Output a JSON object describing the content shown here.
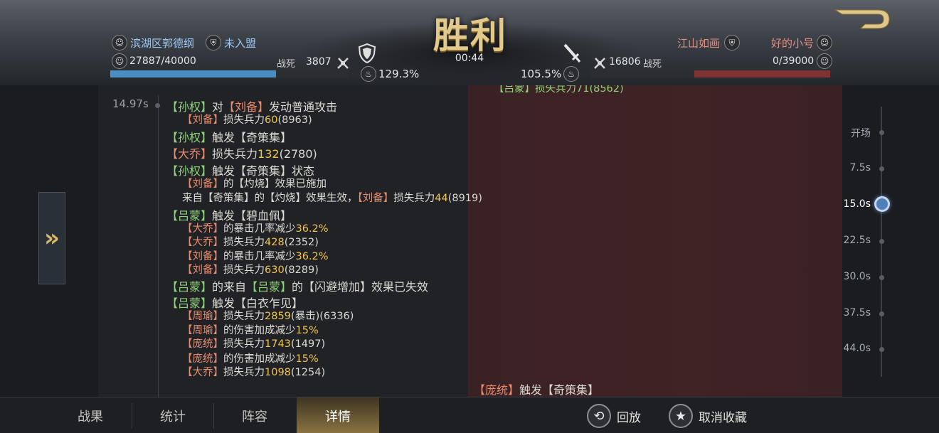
{
  "header": {
    "result_title": "胜利",
    "battle_time": "00:44",
    "back_button_label": ""
  },
  "player": {
    "name": "滨湖区郭德纲",
    "alliance": "未入盟",
    "troops": "27887/40000",
    "troop_fraction": 0.697,
    "killed_label": "战死",
    "killed_value": "3807",
    "stat_percent": "129.3%",
    "side_color": "#4a8fc4"
  },
  "enemy": {
    "name": "好的小号",
    "alliance": "江山如画",
    "troops": "0/39000",
    "troop_fraction": 0.0,
    "killed_label": "战死",
    "killed_value": "16806",
    "stat_percent": "105.5%",
    "side_color": "#a9403c"
  },
  "log": {
    "timestamp": "14.97s",
    "clipped_top_line": "【吕蒙】损失兵力71(8562)",
    "lines": [
      {
        "id": "l1",
        "size": "big",
        "segments": [
          [
            "g",
            "【孙权】"
          ],
          [
            "w",
            "对"
          ],
          [
            "r",
            "【刘备】"
          ],
          [
            "w",
            "发动普通攻击"
          ]
        ]
      },
      {
        "id": "l2",
        "size": "small",
        "segments": [
          [
            "r",
            "【刘备】"
          ],
          [
            "w",
            "损失兵力"
          ],
          [
            "y",
            "60"
          ],
          [
            "w",
            "(8963)"
          ]
        ]
      },
      {
        "id": "l3",
        "size": "big",
        "segments": [
          [
            "g",
            "【孙权】"
          ],
          [
            "w",
            "触发【奇策集】"
          ]
        ]
      },
      {
        "id": "l4",
        "size": "big",
        "segments": [
          [
            "r",
            "【大乔】"
          ],
          [
            "w",
            "损失兵力"
          ],
          [
            "y",
            "132"
          ],
          [
            "w",
            "(2780)"
          ]
        ]
      },
      {
        "id": "l5",
        "size": "big",
        "segments": [
          [
            "g",
            "【孙权】"
          ],
          [
            "w",
            "触发【奇策集】状态"
          ]
        ]
      },
      {
        "id": "l6",
        "size": "small",
        "segments": [
          [
            "r",
            "【刘备】"
          ],
          [
            "w",
            "的【灼烧】效果已施加"
          ]
        ]
      },
      {
        "id": "l7",
        "size": "small",
        "segments": [
          [
            "w",
            "来自【奇策集】的【灼烧】效果生效，"
          ],
          [
            "r",
            "【刘备】"
          ],
          [
            "w",
            "损失兵力"
          ],
          [
            "y",
            "44"
          ],
          [
            "w",
            "(8919)"
          ]
        ]
      },
      {
        "id": "l8",
        "size": "big",
        "segments": [
          [
            "g",
            "【吕蒙】"
          ],
          [
            "w",
            "触发【碧血佩】"
          ]
        ]
      },
      {
        "id": "l9",
        "size": "small",
        "segments": [
          [
            "r",
            "【大乔】"
          ],
          [
            "w",
            "的暴击几率减少"
          ],
          [
            "y",
            "36.2%"
          ]
        ]
      },
      {
        "id": "l10",
        "size": "small",
        "segments": [
          [
            "r",
            "【大乔】"
          ],
          [
            "w",
            "损失兵力"
          ],
          [
            "y",
            "428"
          ],
          [
            "w",
            "(2352)"
          ]
        ]
      },
      {
        "id": "l11",
        "size": "small",
        "segments": [
          [
            "r",
            "【刘备】"
          ],
          [
            "w",
            "的暴击几率减少"
          ],
          [
            "y",
            "36.2%"
          ]
        ]
      },
      {
        "id": "l12",
        "size": "small",
        "segments": [
          [
            "r",
            "【刘备】"
          ],
          [
            "w",
            "损失兵力"
          ],
          [
            "y",
            "630"
          ],
          [
            "w",
            "(8289)"
          ]
        ]
      },
      {
        "id": "l13",
        "size": "big",
        "segments": [
          [
            "g",
            "【吕蒙】"
          ],
          [
            "w",
            "的来自"
          ],
          [
            "g",
            "【吕蒙】"
          ],
          [
            "w",
            "的【闪避增加】效果已失效"
          ]
        ]
      },
      {
        "id": "l14",
        "size": "big",
        "segments": [
          [
            "g",
            "【吕蒙】"
          ],
          [
            "w",
            "触发【白衣乍见】"
          ]
        ]
      },
      {
        "id": "l15",
        "size": "small",
        "segments": [
          [
            "r",
            "【周瑜】"
          ],
          [
            "w",
            "损失兵力"
          ],
          [
            "y",
            "2859"
          ],
          [
            "w",
            "(暴击)(6336)"
          ]
        ]
      },
      {
        "id": "l16",
        "size": "small",
        "segments": [
          [
            "r",
            "【周瑜】"
          ],
          [
            "w",
            "的伤害加成减少"
          ],
          [
            "y",
            "15%"
          ]
        ]
      },
      {
        "id": "l17",
        "size": "small",
        "segments": [
          [
            "r",
            "【庞统】"
          ],
          [
            "w",
            "损失兵力"
          ],
          [
            "y",
            "1743"
          ],
          [
            "w",
            "(1497)"
          ]
        ]
      },
      {
        "id": "l18",
        "size": "small",
        "segments": [
          [
            "r",
            "【庞统】"
          ],
          [
            "w",
            "的伤害加成减少"
          ],
          [
            "y",
            "15%"
          ]
        ]
      },
      {
        "id": "l19",
        "size": "small",
        "segments": [
          [
            "r",
            "【大乔】"
          ],
          [
            "w",
            "损失兵力"
          ],
          [
            "y",
            "1098"
          ],
          [
            "w",
            "(1254)"
          ]
        ]
      },
      {
        "id": "l20",
        "size": "big",
        "segments": [
          [
            "r",
            "【庞统】"
          ],
          [
            "w",
            "触发【奇策集】"
          ]
        ]
      }
    ]
  },
  "timeline": {
    "marks": [
      "开场",
      "7.5s",
      "15.0s",
      "22.5s",
      "30.0s",
      "37.5s",
      "44.0s"
    ],
    "active_index": 2
  },
  "tabs": [
    {
      "id": "results",
      "label": "战果"
    },
    {
      "id": "stats",
      "label": "统计"
    },
    {
      "id": "lineup",
      "label": "阵容"
    },
    {
      "id": "details",
      "label": "详情"
    }
  ],
  "actions": {
    "replay": "回放",
    "unfavorite": "取消收藏"
  },
  "icons": [
    "shield-icon",
    "sword-icon",
    "skull-icon",
    "crossed-swords-icon",
    "flame-icon",
    "replay-icon",
    "star-icon",
    "double-chevron-icon",
    "back-arrow-icon"
  ]
}
